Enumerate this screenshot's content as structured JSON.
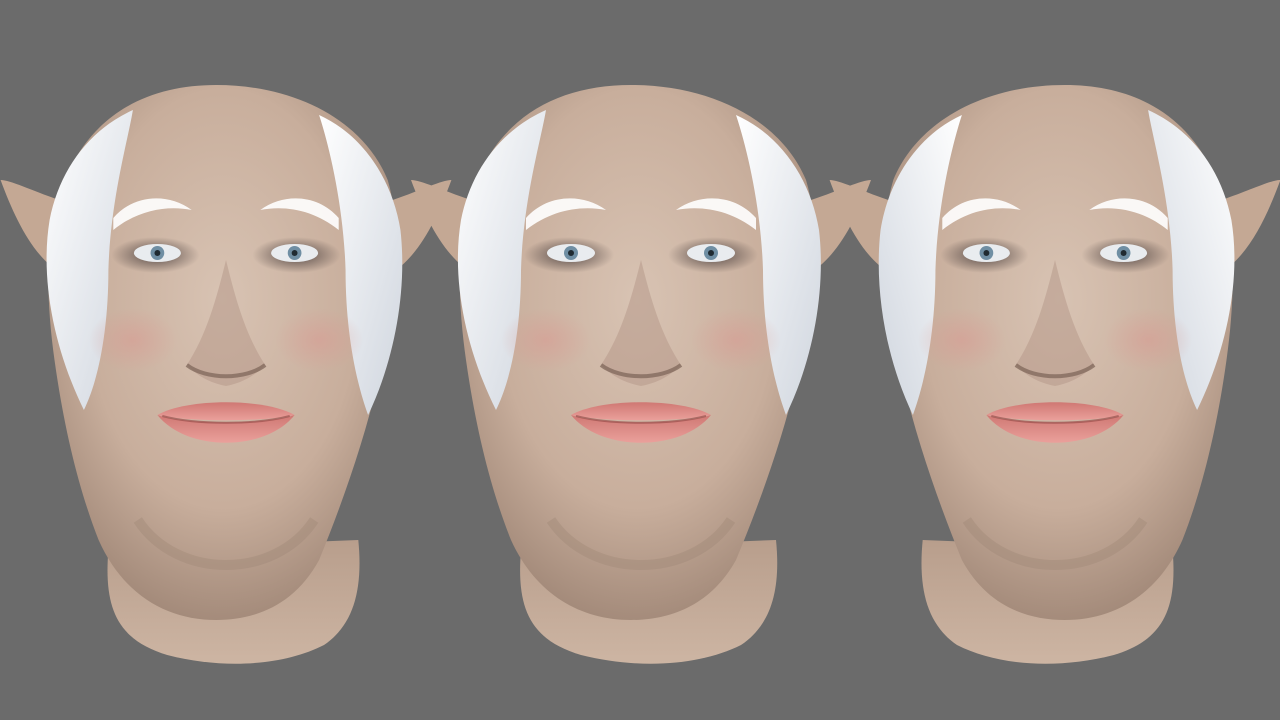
{
  "scene": {
    "description_visible_text": "",
    "background_color": "#6b6b6b",
    "views": [
      {
        "name": "left-three-quarter-view",
        "facing": "left"
      },
      {
        "name": "front-view",
        "facing": "front"
      },
      {
        "name": "right-three-quarter-view",
        "facing": "right"
      }
    ],
    "colors": {
      "skin": "#cdb5a4",
      "skin_shadow": "#a58b7b",
      "hair": "#e8ecf1",
      "lips": "#e08a86",
      "iris": "#6f8ea3"
    }
  }
}
